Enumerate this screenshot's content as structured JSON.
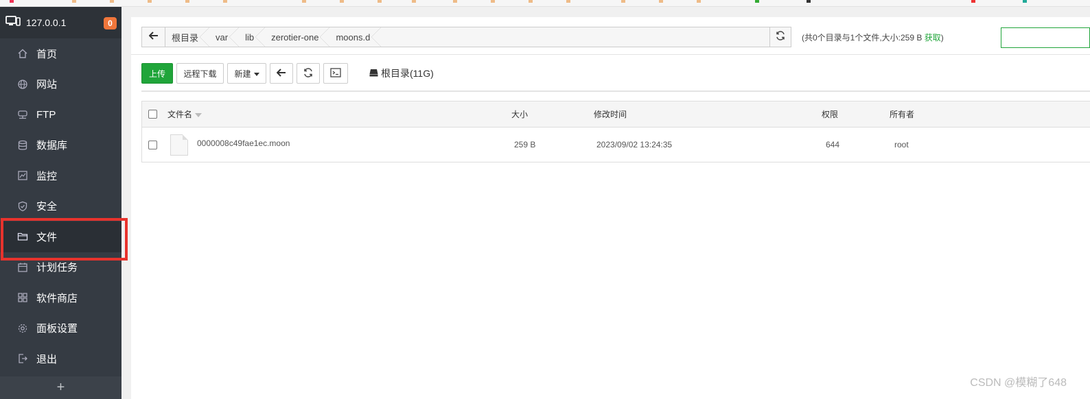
{
  "sidebar": {
    "host": "127.0.0.1",
    "badge": "0",
    "items": [
      {
        "label": "首页",
        "icon": "home-icon"
      },
      {
        "label": "网站",
        "icon": "globe-icon"
      },
      {
        "label": "FTP",
        "icon": "ftp-icon"
      },
      {
        "label": "数据库",
        "icon": "database-icon"
      },
      {
        "label": "监控",
        "icon": "monitor-icon"
      },
      {
        "label": "安全",
        "icon": "shield-icon"
      },
      {
        "label": "文件",
        "icon": "folder-icon",
        "active": true
      },
      {
        "label": "计划任务",
        "icon": "calendar-icon"
      },
      {
        "label": "软件商店",
        "icon": "grid-icon"
      },
      {
        "label": "面板设置",
        "icon": "gear-icon"
      },
      {
        "label": "退出",
        "icon": "logout-icon"
      }
    ],
    "add": "+"
  },
  "path": {
    "crumbs": [
      "根目录",
      "var",
      "lib",
      "zerotier-one",
      "moons.d"
    ]
  },
  "summary": {
    "text": "(共0个目录与1个文件,大小:259 B ",
    "get": "获取",
    "close": ")"
  },
  "toolbar": {
    "upload": "上传",
    "remote_download": "远程下载",
    "new": "新建",
    "disk": "根目录(11G)"
  },
  "table": {
    "headers": {
      "name": "文件名",
      "size": "大小",
      "mtime": "修改时间",
      "perm": "权限",
      "owner": "所有者"
    },
    "rows": [
      {
        "name": "0000008c49fae1ec.moon",
        "size": "259 B",
        "mtime": "2023/09/02 13:24:35",
        "perm": "644",
        "owner": "root"
      }
    ]
  },
  "watermark": "CSDN @模糊了648",
  "colors": {
    "sidebar_bg": "#353b43",
    "accent_green": "#20a53a",
    "badge_orange": "#f0763b",
    "highlight_red": "#e8332d"
  }
}
